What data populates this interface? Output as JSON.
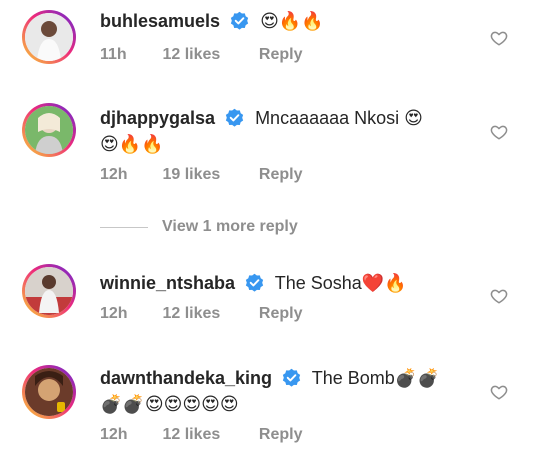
{
  "comments": [
    {
      "username": "buhlesamuels",
      "text": "",
      "emoji_line1": "😍🔥🔥",
      "emoji_line2": "",
      "time": "11h",
      "likes": "12 likes",
      "reply": "Reply",
      "avatar_colors": [
        "#cfcfcf",
        "#ffffff"
      ]
    },
    {
      "username": "djhappygalsa",
      "text": "Mncaaaaaa Nkosi",
      "emoji_line1": "😍",
      "emoji_line2": "😍🔥🔥",
      "time": "12h",
      "likes": "19 likes",
      "reply": "Reply",
      "avatar_colors": [
        "#7ab86a",
        "#e8d6c4"
      ]
    },
    {
      "username": "winnie_ntshaba",
      "text": "The Sosha",
      "emoji_line1": "❤️🔥",
      "emoji_line2": "",
      "time": "12h",
      "likes": "12 likes",
      "reply": "Reply",
      "avatar_colors": [
        "#b8b0a8",
        "#c23b3b"
      ]
    },
    {
      "username": "dawnthandeka_king",
      "text": "The Bomb",
      "emoji_line1": "💣💣",
      "emoji_line2": "💣💣😍😍😍😍😍",
      "time": "12h",
      "likes": "12 likes",
      "reply": "Reply",
      "avatar_colors": [
        "#6b3b2a",
        "#d4a373"
      ]
    }
  ],
  "view_more_replies": "View 1 more reply",
  "colors": {
    "primary_text": "#262626",
    "secondary_text": "#8e8e8e",
    "verified_blue": "#3897f0",
    "story_ring": [
      "#f9ce34",
      "#ee2a7b",
      "#6228d7"
    ]
  },
  "icons": {
    "verified": "verified-badge-icon",
    "like": "heart-outline-icon"
  }
}
